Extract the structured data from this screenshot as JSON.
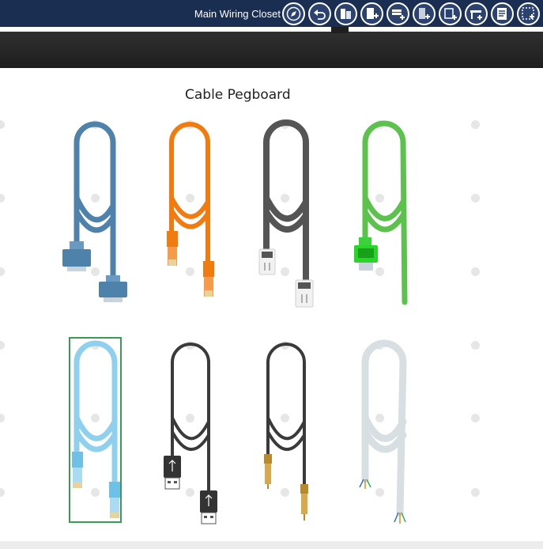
{
  "toolbar": {
    "location_label": "Main Wiring Closet",
    "buttons": [
      {
        "icon": "navigate-icon"
      },
      {
        "icon": "back-icon"
      },
      {
        "icon": "device-icon"
      },
      {
        "icon": "add-rack-icon"
      },
      {
        "icon": "add-shelf-icon"
      },
      {
        "icon": "add-device-icon"
      },
      {
        "icon": "add-module-icon"
      },
      {
        "icon": "add-table-icon"
      },
      {
        "icon": "inspect-icon"
      },
      {
        "icon": "more-options-icon"
      }
    ]
  },
  "board": {
    "title": "Cable Pegboard",
    "selected_cable": "straight-ethernet-cable",
    "cables": [
      {
        "id": "console-cable",
        "color": "#4f82ab",
        "connector": "db9"
      },
      {
        "id": "copper-straight-through-cable",
        "color": "#f27b10",
        "connector": "rj45"
      },
      {
        "id": "phone-cable",
        "color": "#555555",
        "connector": "rj11"
      },
      {
        "id": "serial-cable",
        "color": "#5cc24d",
        "connector": "dce"
      },
      {
        "id": "straight-ethernet-cable",
        "color": "#8fd0ef",
        "connector": "rj45"
      },
      {
        "id": "usb-cable",
        "color": "#3a3a3a",
        "connector": "usb"
      },
      {
        "id": "coaxial-cable",
        "color": "#3a3a3a",
        "connector": "coax"
      },
      {
        "id": "fiber-cable",
        "color": "#d7dfe3",
        "connector": "bare"
      }
    ]
  }
}
